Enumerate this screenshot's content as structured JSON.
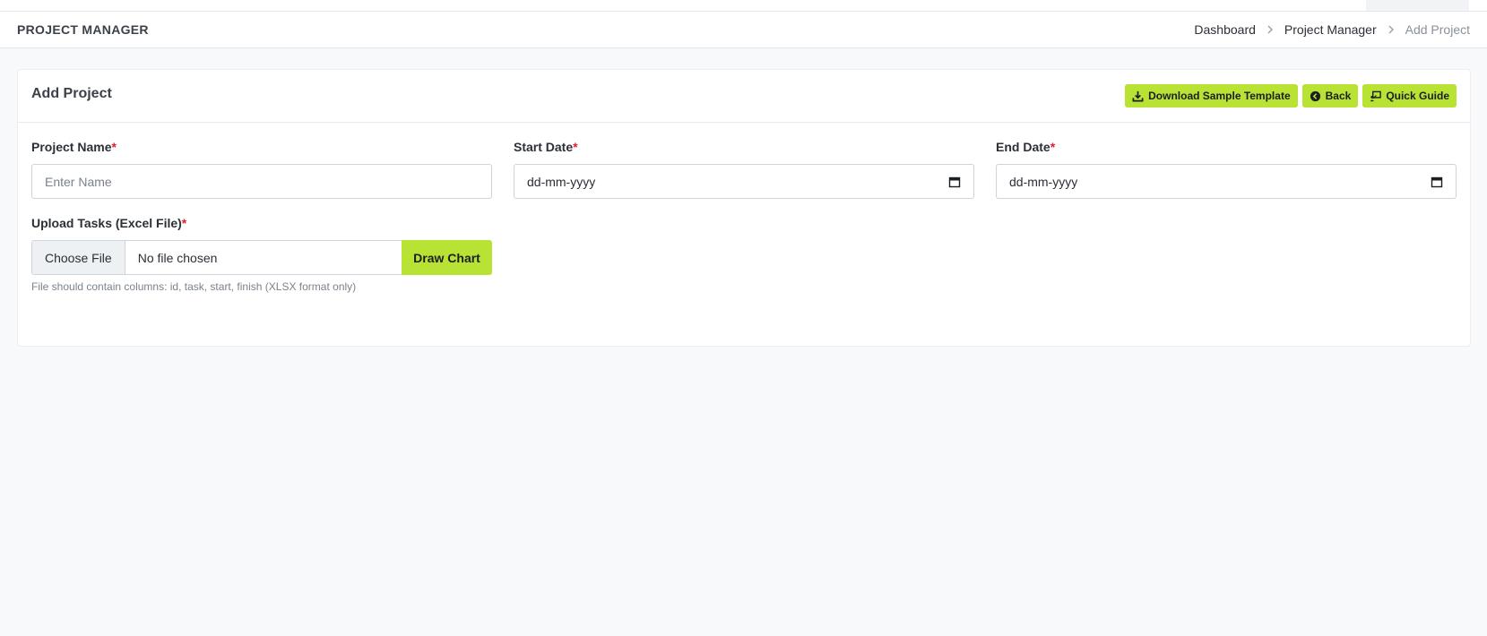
{
  "header": {
    "title": "PROJECT MANAGER",
    "breadcrumb": {
      "items": [
        "Dashboard",
        "Project Manager"
      ],
      "current": "Add Project"
    }
  },
  "card": {
    "title": "Add Project",
    "actions": {
      "download_label": "Download Sample Template",
      "back_label": "Back",
      "guide_label": "Quick Guide"
    }
  },
  "form": {
    "project_name": {
      "label": "Project Name",
      "required": "*",
      "placeholder": "Enter Name"
    },
    "start_date": {
      "label": "Start Date",
      "required": "*",
      "value": "dd-mm-yyyy"
    },
    "end_date": {
      "label": "End Date",
      "required": "*",
      "value": "dd-mm-yyyy"
    },
    "upload": {
      "label": "Upload Tasks (Excel File)",
      "required": "*",
      "choose_label": "Choose File",
      "file_status": "No file chosen",
      "draw_label": "Draw Chart",
      "hint": "File should contain columns: id, task, start, finish (XLSX format only)"
    }
  },
  "colors": {
    "accent": "#b8e234",
    "required": "#e11d2e",
    "background": "#f8f9fb"
  }
}
